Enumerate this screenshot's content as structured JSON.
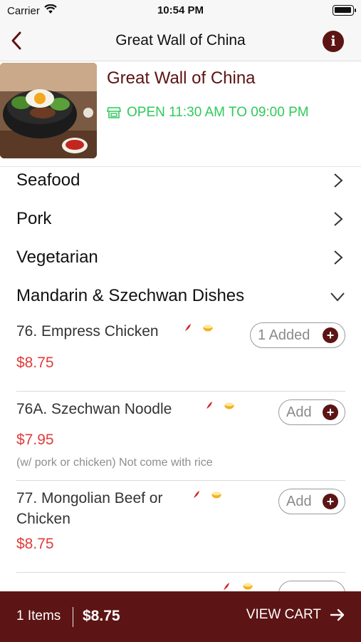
{
  "status_bar": {
    "carrier": "Carrier",
    "time": "10:54 PM"
  },
  "nav": {
    "title": "Great Wall of China"
  },
  "restaurant": {
    "name": "Great Wall of China",
    "hours": "OPEN 11:30 AM TO 09:00 PM",
    "hours_color": "#2fc95a"
  },
  "categories": [
    {
      "label": "Seafood",
      "icon": "chevron-right-icon"
    },
    {
      "label": "Pork",
      "icon": "chevron-right-icon"
    },
    {
      "label": "Vegetarian",
      "icon": "chevron-right-icon"
    },
    {
      "label": "Mandarin & Szechwan Dishes",
      "icon": "chevron-down-icon"
    }
  ],
  "items": [
    {
      "name": "76. Empress Chicken",
      "price": "$8.75",
      "note": "",
      "button": "1 Added",
      "tags": [
        "spicy-icon",
        "rice-icon"
      ]
    },
    {
      "name": "76A. Szechwan Noodle",
      "price": "$7.95",
      "note": "(w/ pork or chicken) Not come with rice",
      "button": "Add",
      "tags": [
        "spicy-icon",
        "rice-icon"
      ]
    },
    {
      "name_line1": "77. Mongolian Beef or",
      "name_line2": "Chicken",
      "price": "$8.75",
      "note": "",
      "button": "Add",
      "tags": [
        "spicy-icon",
        "rice-icon"
      ]
    }
  ],
  "cart": {
    "count": "1 Items",
    "total": "$8.75",
    "action": "VIEW CART"
  },
  "colors": {
    "brand": "#5c1414",
    "price": "#e23b3b",
    "open": "#2fc95a"
  }
}
